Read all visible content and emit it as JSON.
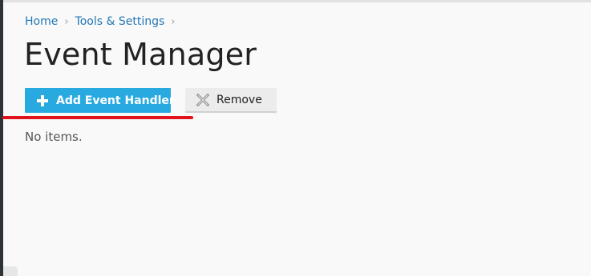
{
  "breadcrumb": {
    "items": [
      {
        "label": "Home"
      },
      {
        "label": "Tools & Settings"
      }
    ],
    "separator": "›"
  },
  "page": {
    "title": "Event Manager",
    "empty_message": "No items."
  },
  "toolbar": {
    "add_label": "Add Event Handler",
    "add_icon": "plus-icon",
    "remove_label": "Remove",
    "remove_icon": "remove-x-icon"
  },
  "colors": {
    "accent": "#28aae1",
    "link": "#2277b5",
    "annotation": "#e0141c"
  }
}
